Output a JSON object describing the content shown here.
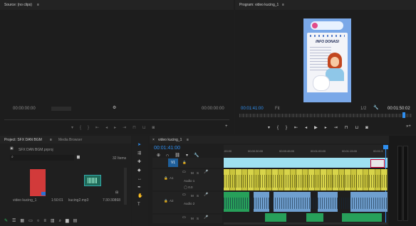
{
  "source_panel": {
    "title": "Source: (no clips)",
    "menu": "≡",
    "timecode_in": "00:00:00:00",
    "timecode_out": "00:00:00:00"
  },
  "program_panel": {
    "title": "Program: video kucing_1",
    "menu": "≡",
    "timecode": "00:01:41:00",
    "fit": "Fit",
    "resolution": "1/2",
    "duration": "00:01:50:02",
    "poster": {
      "title": "INFO DONASI"
    }
  },
  "project_panel": {
    "tab_project": "Project: SFX DAN BGM",
    "tab_media": "Media Browser",
    "menu": "≡",
    "file": "SFX DAN BGM.prproj",
    "items_count": "32 Items",
    "items": [
      {
        "name": "video kucing_1",
        "duration": "1:50:01"
      },
      {
        "name": "kucing2.mp3",
        "duration": "7:30:30868"
      }
    ]
  },
  "timeline_panel": {
    "tab": "video kucing_1",
    "menu": "≡",
    "timecode": "00:01:41:00",
    "ruler": [
      ":00:00",
      "00:00:30:00",
      "00:00:45:00",
      "00:01:00:00",
      "00:01:15:00",
      "00:01:3"
    ],
    "tracks": [
      {
        "id": "V1",
        "label": ""
      },
      {
        "id": "A1",
        "label": "Audio 1"
      },
      {
        "id": "A2",
        "label": "Audio 2"
      }
    ],
    "track_buttons": [
      "M",
      "S"
    ]
  },
  "colors": {
    "accent": "#2f8ff0",
    "video_clip": "#d8d44a",
    "audio_clip": "#27a05a",
    "selection_bar": "#9fe0f0",
    "project_video_thumb": "#d23a3a"
  }
}
